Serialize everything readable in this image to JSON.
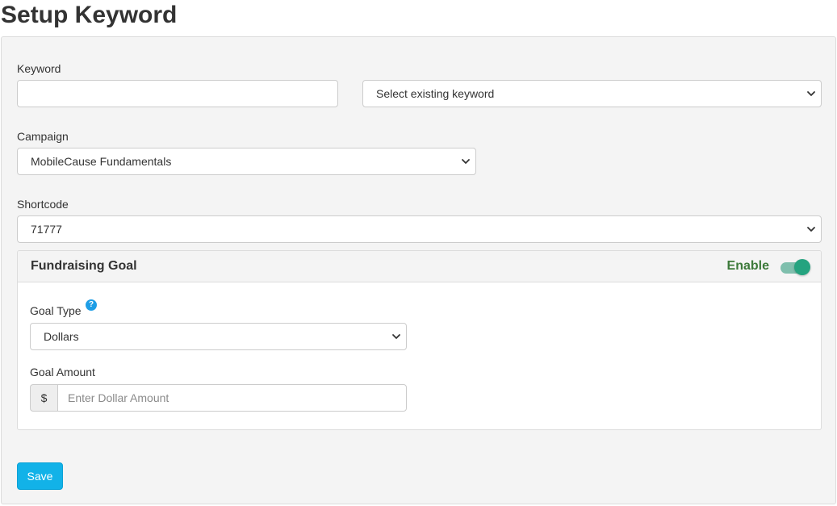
{
  "page": {
    "title": "Setup Keyword"
  },
  "form": {
    "keyword": {
      "label": "Keyword",
      "value": "",
      "existing_select": "Select existing keyword"
    },
    "campaign": {
      "label": "Campaign",
      "selected": "MobileCause Fundamentals"
    },
    "shortcode": {
      "label": "Shortcode",
      "selected": "71777"
    },
    "fundraising_goal": {
      "title": "Fundraising Goal",
      "enable_label": "Enable",
      "enabled": true,
      "goal_type": {
        "label": "Goal Type",
        "help_icon": "?",
        "selected": "Dollars"
      },
      "goal_amount": {
        "label": "Goal Amount",
        "currency_symbol": "$",
        "placeholder": "Enter Dollar Amount",
        "value": ""
      }
    },
    "save_label": "Save"
  },
  "colors": {
    "accent_button": "#12b2e8",
    "toggle_on": "#24a37f",
    "enable_text": "#3d7a3a",
    "help_icon": "#1e9ee6"
  },
  "icons": {
    "select_chevron": "chevron-down-icon",
    "help": "question-circle-icon"
  }
}
